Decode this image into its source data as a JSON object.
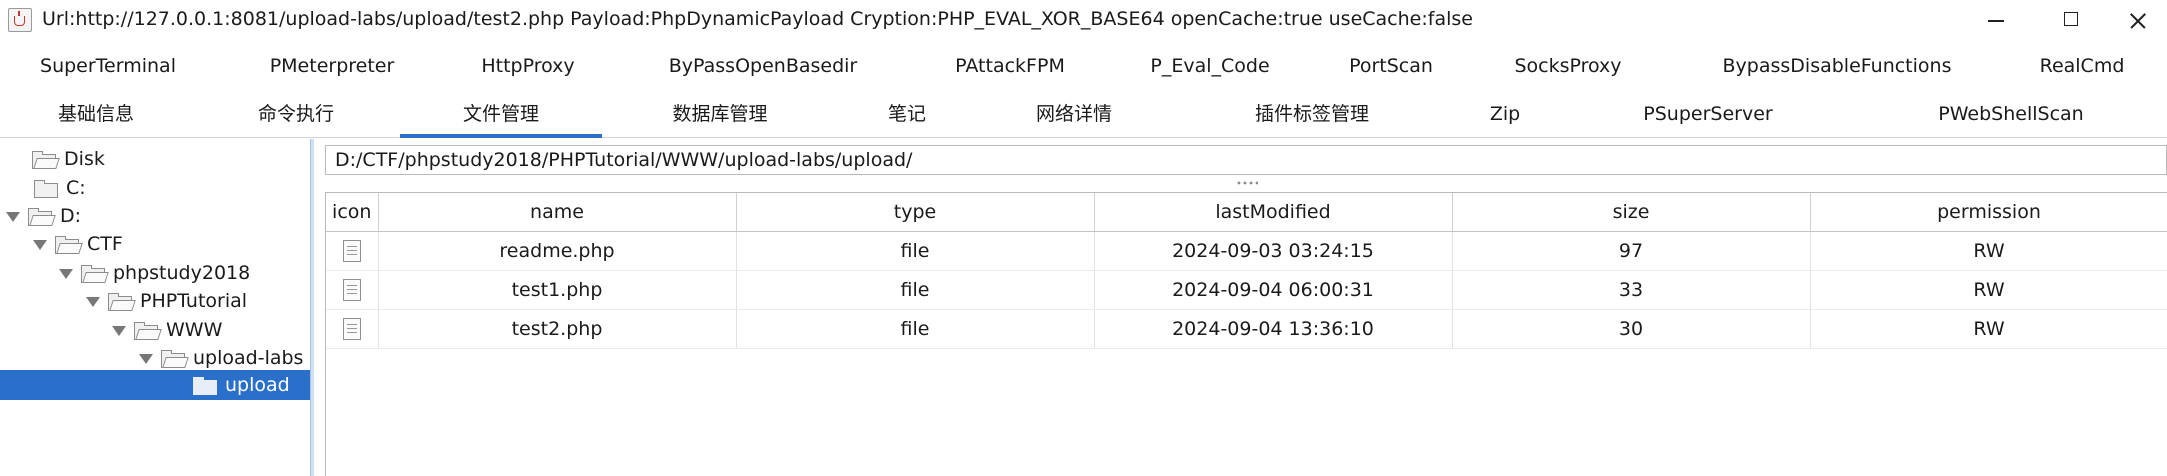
{
  "window": {
    "title": "Url:http://127.0.0.1:8081/upload-labs/upload/test2.php Payload:PhpDynamicPayload Cryption:PHP_EVAL_XOR_BASE64 openCache:true useCache:false"
  },
  "tabs_row1": [
    "SuperTerminal",
    "PMeterpreter",
    "HttpProxy",
    "ByPassOpenBasedir",
    "PAttackFPM",
    "P_Eval_Code",
    "PortScan",
    "SocksProxy",
    "BypassDisableFunctions",
    "RealCmd"
  ],
  "tabs_row2": [
    "基础信息",
    "命令执行",
    "文件管理",
    "数据库管理",
    "笔记",
    "网络详情",
    "插件标签管理",
    "Zip",
    "PSuperServer",
    "PWebShellScan"
  ],
  "active_tab": "文件管理",
  "tree": {
    "disk": "Disk",
    "c": "C:",
    "d": "D:",
    "ctf": "CTF",
    "phpstudy": "phpstudy2018",
    "phptutorial": "PHPTutorial",
    "www": "WWW",
    "upload_labs": "upload-labs",
    "upload": "upload",
    "selected": "upload"
  },
  "path": "D:/CTF/phpstudy2018/PHPTutorial/WWW/upload-labs/upload/",
  "table": {
    "headers": {
      "icon": "icon",
      "name": "name",
      "type": "type",
      "lastModified": "lastModified",
      "size": "size",
      "permission": "permission"
    },
    "rows": [
      {
        "name": "readme.php",
        "type": "file",
        "lastModified": "2024-09-03 03:24:15",
        "size": "97",
        "permission": "RW",
        "icon": "file-icon"
      },
      {
        "name": "test1.php",
        "type": "file",
        "lastModified": "2024-09-04 06:00:31",
        "size": "33",
        "permission": "RW",
        "icon": "file-icon"
      },
      {
        "name": "test2.php",
        "type": "file",
        "lastModified": "2024-09-04 13:36:10",
        "size": "30",
        "permission": "RW",
        "icon": "file-icon"
      }
    ]
  },
  "colors": {
    "accent": "#2a6fc9",
    "selection": "#2a6fc9"
  }
}
